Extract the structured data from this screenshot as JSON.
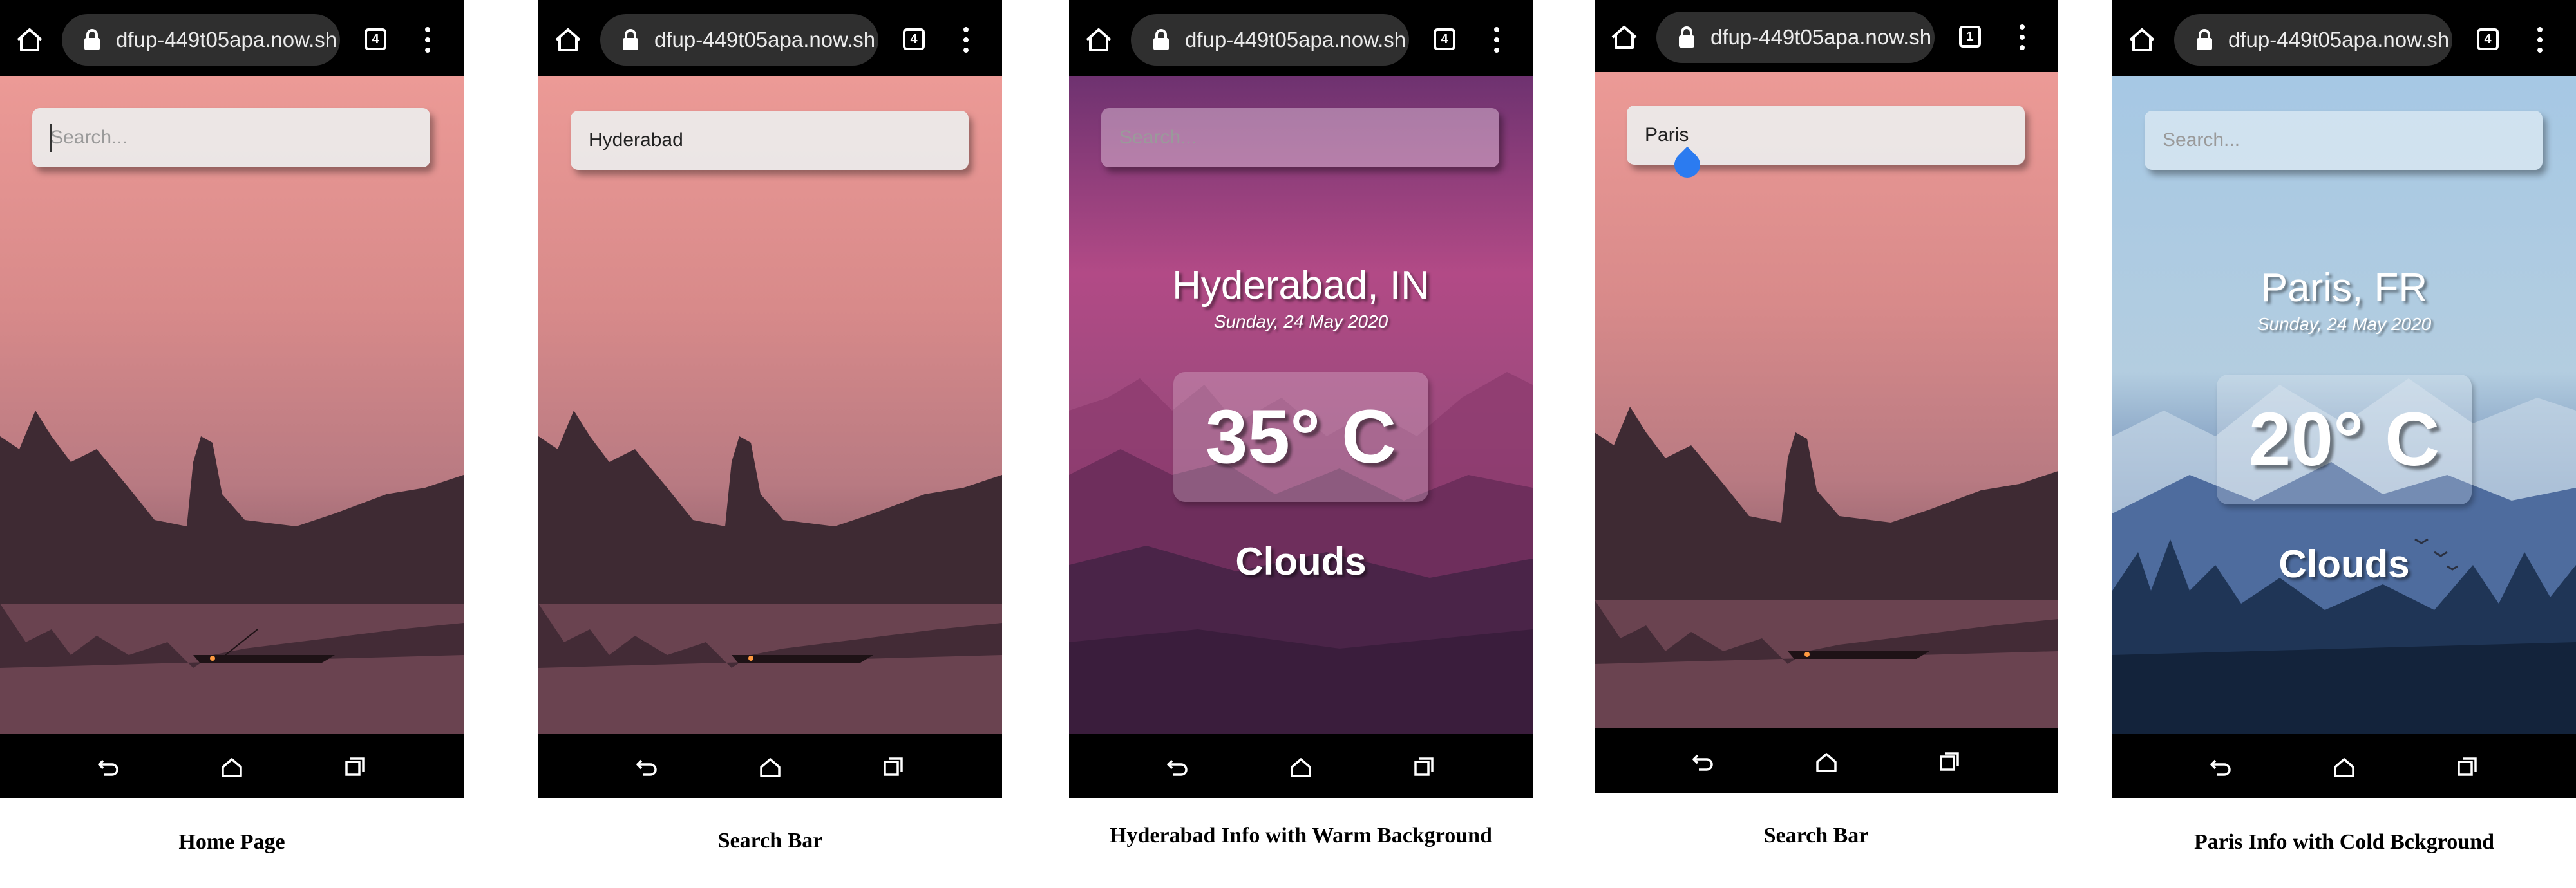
{
  "browser": {
    "url": "dfup-449t05apa.now.sh"
  },
  "screens": [
    {
      "tab_count": "4",
      "search_value": "",
      "search_placeholder": "Search...",
      "caption": "Home Page"
    },
    {
      "tab_count": "4",
      "search_value": "Hyderabad",
      "search_placeholder": "Search...",
      "caption": "Search Bar"
    },
    {
      "tab_count": "4",
      "search_value": "",
      "search_placeholder": "Search...",
      "city": "Hyderabad, IN",
      "date": "Sunday, 24 May 2020",
      "temperature": "35° C",
      "condition": "Clouds",
      "caption": "Hyderabad Info with Warm Background"
    },
    {
      "tab_count": "1",
      "search_value": "Paris",
      "search_placeholder": "Search...",
      "caption": "Search Bar"
    },
    {
      "tab_count": "4",
      "search_value": "",
      "search_placeholder": "Search...",
      "city": "Paris, FR",
      "date": "Sunday, 24 May 2020",
      "temperature": "20° C",
      "condition": "Clouds",
      "caption": "Paris Info with Cold Bckground"
    }
  ],
  "icons": {
    "home": "home-icon",
    "lock": "lock-icon",
    "tabs": "tab-switcher-icon",
    "menu": "more-vert-icon",
    "back": "back-arrow-icon",
    "nav_home": "home-outline-icon",
    "recents": "recents-icon"
  },
  "theme": {
    "warm_top": "#e89898",
    "warm_bottom": "#6a3a48",
    "purple_top": "#7a3672",
    "purple_bottom": "#3a1e3e",
    "cold_top": "#9fc2e0",
    "cold_bottom": "#15263f",
    "text": "#ffffff"
  }
}
